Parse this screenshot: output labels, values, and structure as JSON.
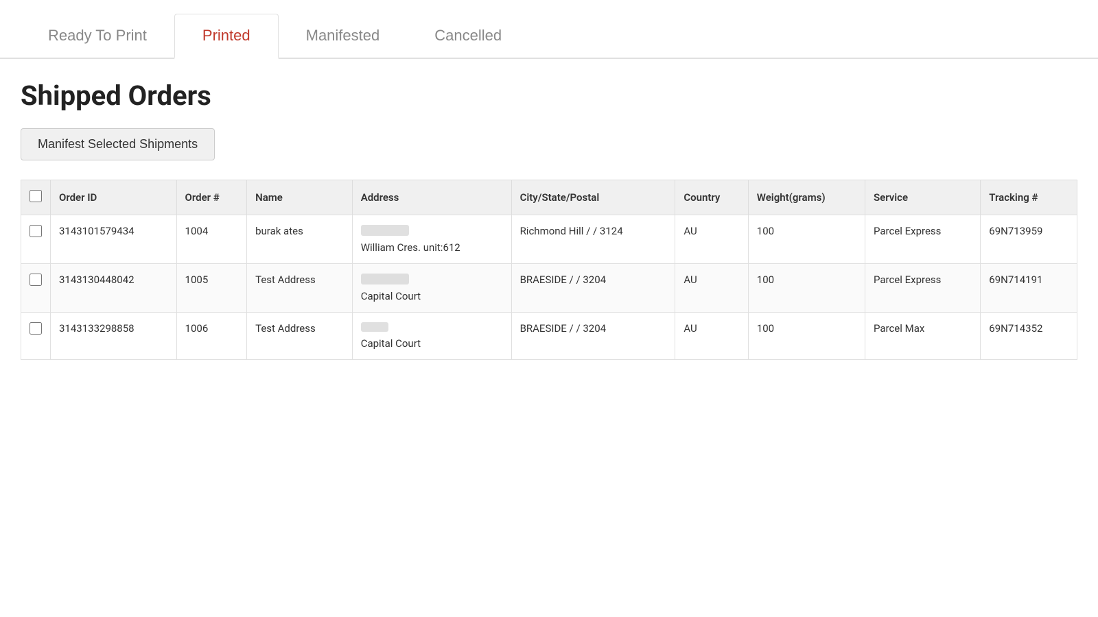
{
  "tabs": [
    {
      "id": "ready",
      "label": "Ready To Print",
      "active": false
    },
    {
      "id": "printed",
      "label": "Printed",
      "active": true
    },
    {
      "id": "manifested",
      "label": "Manifested",
      "active": false
    },
    {
      "id": "cancelled",
      "label": "Cancelled",
      "active": false
    }
  ],
  "page": {
    "title": "Shipped Orders",
    "manifest_button": "Manifest Selected Shipments"
  },
  "table": {
    "columns": [
      "",
      "Order ID",
      "Order #",
      "Name",
      "Address",
      "City/State/Postal",
      "Country",
      "Weight(grams)",
      "Service",
      "Tracking #"
    ],
    "rows": [
      {
        "order_id": "3143101579434",
        "order_num": "1004",
        "name": "burak ates",
        "address_line1": "[redacted]",
        "address_line2": "William Cres. unit:612",
        "city_state_postal": "Richmond Hill / / 3124",
        "country": "AU",
        "weight": "100",
        "service": "Parcel Express",
        "tracking": "69N713959"
      },
      {
        "order_id": "3143130448042",
        "order_num": "1005",
        "name": "Test Address",
        "address_line1": "[redacted]",
        "address_line2": "Capital Court",
        "city_state_postal": "BRAESIDE / / 3204",
        "country": "AU",
        "weight": "100",
        "service": "Parcel Express",
        "tracking": "69N714191"
      },
      {
        "order_id": "3143133298858",
        "order_num": "1006",
        "name": "Test Address",
        "address_line1": "[redacted]",
        "address_line2": "Capital Court",
        "city_state_postal": "BRAESIDE / / 3204",
        "country": "AU",
        "weight": "100",
        "service": "Parcel Max",
        "tracking": "69N714352"
      }
    ]
  }
}
